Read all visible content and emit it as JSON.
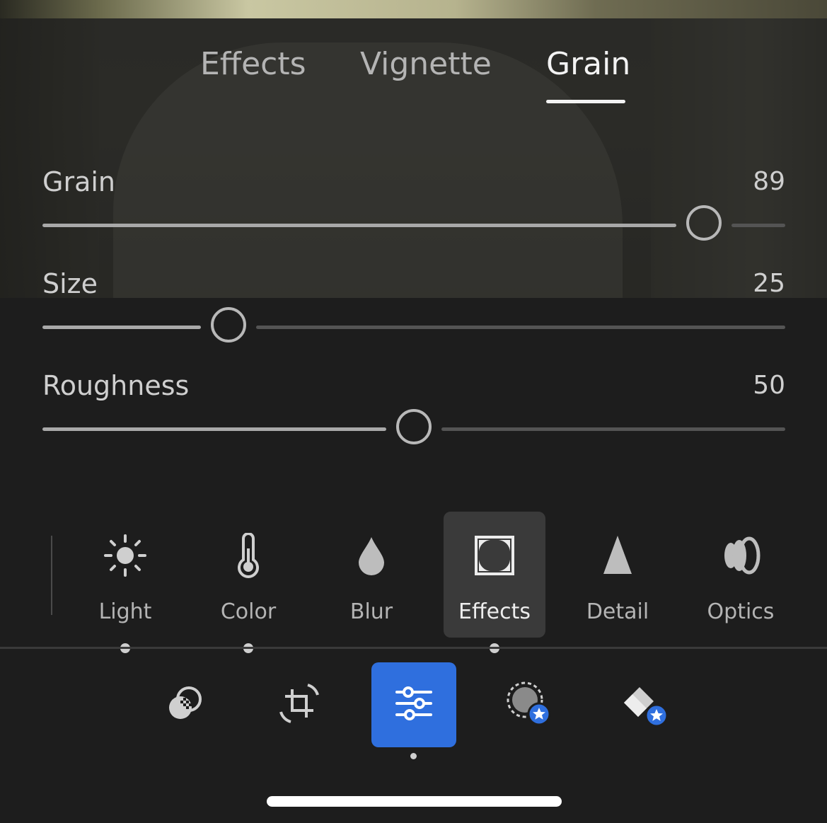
{
  "tabs": [
    {
      "label": "Effects",
      "active": false
    },
    {
      "label": "Vignette",
      "active": false
    },
    {
      "label": "Grain",
      "active": true
    }
  ],
  "sliders": [
    {
      "label": "Grain",
      "value": "89",
      "fraction": 0.89
    },
    {
      "label": "Size",
      "value": "25",
      "fraction": 0.25
    },
    {
      "label": "Roughness",
      "value": "50",
      "fraction": 0.5
    }
  ],
  "tools": [
    {
      "label": "Light",
      "icon": "sun-icon",
      "has_edits": true
    },
    {
      "label": "Color",
      "icon": "thermometer-icon",
      "has_edits": true
    },
    {
      "label": "Blur",
      "icon": "droplet-icon",
      "has_edits": false
    },
    {
      "label": "Effects",
      "icon": "vignette-frame-icon",
      "has_edits": true,
      "selected": true
    },
    {
      "label": "Detail",
      "icon": "triangle-icon",
      "has_edits": false
    },
    {
      "label": "Optics",
      "icon": "lens-icon",
      "has_edits": false
    }
  ],
  "nav": [
    {
      "icon": "presets-icon",
      "active": false
    },
    {
      "icon": "crop-rotate-icon",
      "active": false
    },
    {
      "icon": "adjust-sliders-icon",
      "active": true
    },
    {
      "icon": "masking-premium-icon",
      "active": false
    },
    {
      "icon": "healing-eraser-premium-icon",
      "active": false
    }
  ],
  "colors": {
    "accent": "#2f6fde",
    "background": "#1d1d1d",
    "premium_badge": "#2f6fde"
  }
}
